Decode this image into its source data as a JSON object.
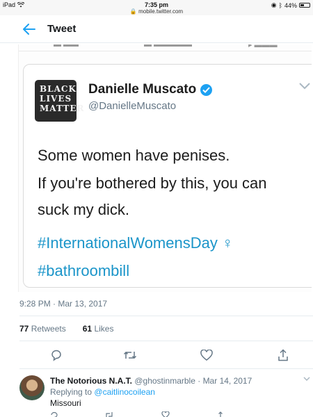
{
  "status_bar": {
    "device": "iPad",
    "time": "7:35 pm",
    "url": "mobile.twitter.com",
    "battery": "44%",
    "battery_level": 0.44
  },
  "header": {
    "title": "Tweet",
    "back_icon": "arrow-left-icon"
  },
  "embedded_tweet": {
    "author_name": "Danielle Muscato",
    "author_handle": "@DanielleMuscato",
    "avatar_text": [
      "BLACK",
      "LIVES",
      "MATTER"
    ],
    "lines": [
      "Some women have penises.",
      "If you're bothered by this, you can",
      "suck my dick."
    ],
    "hashtags": [
      "#InternationalWomensDay ♀",
      "#bathroombill"
    ],
    "accent_color": "#1da1f2"
  },
  "tweet": {
    "timestamp": "9:28 PM · Mar 13, 2017",
    "retweets_count": "77",
    "retweets_label": "Retweets",
    "likes_count": "61",
    "likes_label": "Likes"
  },
  "reply": {
    "display_name": "The Notorious N.A.T.",
    "handle_date": "@ghostinmarble · Mar 14, 2017",
    "replying_prefix": "Replying to",
    "replying_to": "@caitlinocoilean",
    "text": "Missouri"
  }
}
